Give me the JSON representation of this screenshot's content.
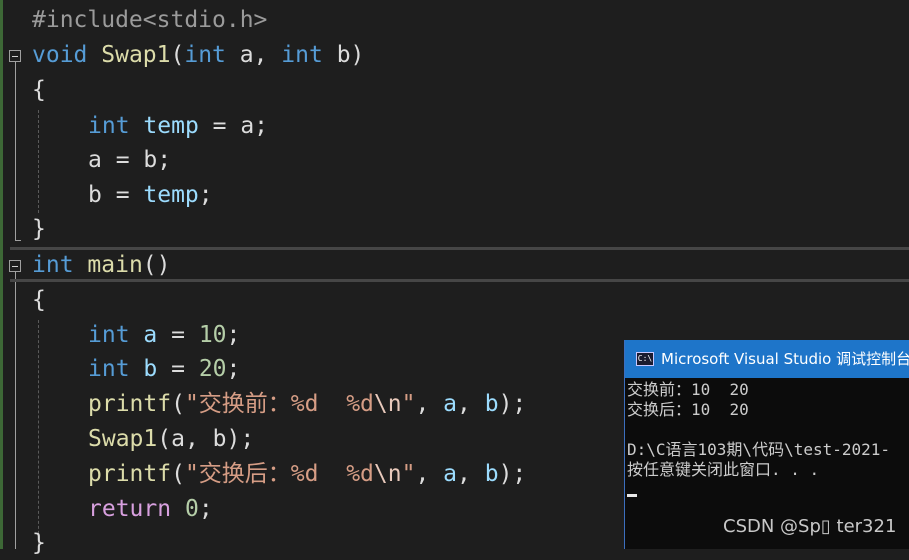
{
  "editor": {
    "lines": {
      "l0": {
        "text": "#include<stdio.h>"
      },
      "l1": {
        "kw1": "void",
        "fn": "Swap1",
        "p1": "(",
        "kw2": "int",
        "a": " a, ",
        "kw3": "int",
        "b": " b)"
      },
      "l2": {
        "text": "{"
      },
      "l3": {
        "kw": "int",
        "var": "temp",
        "rest": " = a;"
      },
      "l4": {
        "text": "a = b;"
      },
      "l5": {
        "a": "b = ",
        "var": "temp",
        "end": ";"
      },
      "l6": {
        "text": "}"
      },
      "l7": {
        "kw": "int",
        "fn": "main",
        "rest": "()"
      },
      "l8": {
        "text": "{"
      },
      "l9": {
        "kw": "int",
        "var": "a",
        "eq": " = ",
        "num": "10",
        "end": ";"
      },
      "l10": {
        "kw": "int",
        "var": "b",
        "eq": " = ",
        "num": "20",
        "end": ";"
      },
      "l11": {
        "fn": "printf",
        "open": "(",
        "str": "\"交换前：%d  %d",
        "esc": "\\n",
        "q": "\"",
        "args": ", ",
        "a": "a",
        "comma": ", ",
        "b": "b",
        "end": ");"
      },
      "l12": {
        "fn": "Swap1",
        "rest": "(a, b);"
      },
      "l13": {
        "fn": "printf",
        "open": "(",
        "str": "\"交换后：%d  %d",
        "esc": "\\n",
        "q": "\"",
        "args": ", ",
        "a": "a",
        "comma": ", ",
        "b": "b",
        "end": ");"
      },
      "l14": {
        "kw": "return",
        "num": "0",
        "end": ";"
      },
      "l15": {
        "text": "}"
      }
    }
  },
  "console": {
    "title": "Microsoft Visual Studio 调试控制台",
    "icon_text": "C:\\",
    "output": [
      "交换前：10  20",
      "交换后：10  20",
      "",
      "D:\\C语言103期\\代码\\test-2021-",
      "按任意键关闭此窗口. . ."
    ]
  },
  "watermark": "CSDN @Sp▯ ter321",
  "colors": {
    "background": "#1e1e1e",
    "keyword": "#569cd6",
    "function": "#dcdcaa",
    "variable": "#9cdcfe",
    "number": "#b5cea8",
    "string": "#d69d85",
    "control": "#d8a0df",
    "console_title_bg": "#1e75c9"
  }
}
